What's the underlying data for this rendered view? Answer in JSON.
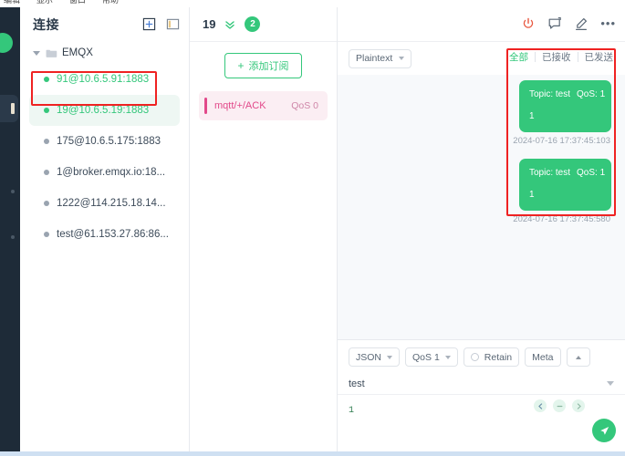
{
  "os_menubar": {
    "items": [
      "编辑",
      "显示",
      "窗口",
      "帮助"
    ]
  },
  "rail": {
    "avatar_name": "user-avatar"
  },
  "left_panel": {
    "title": "连接",
    "actions": [
      {
        "name": "new-connection-icon",
        "label": "+"
      },
      {
        "name": "toggle-panel-icon",
        "label": "▥"
      }
    ],
    "group": {
      "label": "EMQX",
      "expanded": true
    },
    "connections": [
      {
        "label": "91@10.6.5.91:1883",
        "online": true,
        "selected": false,
        "highlighted": true
      },
      {
        "label": "19@10.6.5.19:1883",
        "online": true,
        "selected": true,
        "highlighted": false
      },
      {
        "label": "175@10.6.5.175:1883",
        "online": false,
        "selected": false,
        "highlighted": false
      },
      {
        "label": "1@broker.emqx.io:18...",
        "online": false,
        "selected": false,
        "highlighted": false
      },
      {
        "label": "1222@114.215.18.14...",
        "online": false,
        "selected": false,
        "highlighted": false
      },
      {
        "label": "test@61.153.27.86:86...",
        "online": false,
        "selected": false,
        "highlighted": false
      }
    ]
  },
  "mid_panel": {
    "title": "19",
    "collapse_icon": "double-chevron-down-icon",
    "badge_count": "2",
    "add_subscription_label": "添加订阅",
    "add_subscription_plus": "+",
    "subscriptions": [
      {
        "topic": "mqtt/+/ACK",
        "qos": "QoS 0"
      }
    ]
  },
  "right_panel": {
    "header_actions": [
      {
        "name": "disconnect-power-icon"
      },
      {
        "name": "new-message-icon"
      },
      {
        "name": "edit-pencil-icon"
      },
      {
        "name": "more-options-icon",
        "label": "•••"
      }
    ],
    "payload_format": "Plaintext",
    "message_tabs": [
      {
        "label": "全部",
        "active": true
      },
      {
        "label": "已接收",
        "active": false
      },
      {
        "label": "已发送",
        "active": false
      }
    ],
    "messages": [
      {
        "topic_label": "Topic: test",
        "qos_label": "QoS: 1",
        "payload": "1",
        "time": "2024-07-16 17:37:45:103"
      },
      {
        "topic_label": "Topic: test",
        "qos_label": "QoS: 1",
        "payload": "1",
        "time": "2024-07-16 17:37:45:580"
      }
    ],
    "composer": {
      "format": "JSON",
      "qos": "QoS 1",
      "retain_label": "Retain",
      "retain_checked": false,
      "meta_label": "Meta",
      "collapse_name": "collapse-composer-icon",
      "topic_value": "test",
      "payload_value": "1",
      "history_prev_name": "history-prev-icon",
      "history_clear_name": "history-clear-icon",
      "history_next_name": "history-next-icon",
      "send_name": "send-button"
    }
  },
  "colors": {
    "accent_green": "#34c77b",
    "annotation_red": "#ef2222",
    "sub_pink": "#e2498a",
    "rail_navy": "#1e2b38"
  }
}
